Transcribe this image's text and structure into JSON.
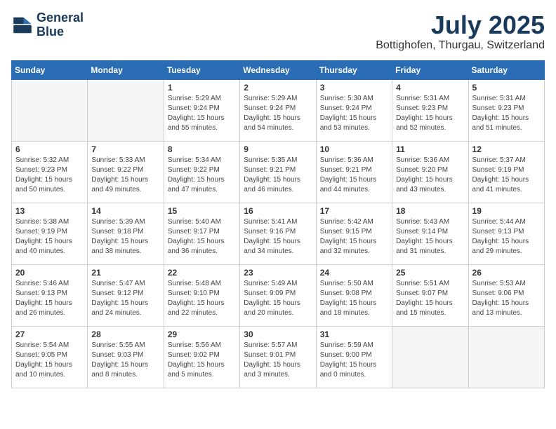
{
  "header": {
    "logo_line1": "General",
    "logo_line2": "Blue",
    "month": "July 2025",
    "location": "Bottighofen, Thurgau, Switzerland"
  },
  "weekdays": [
    "Sunday",
    "Monday",
    "Tuesday",
    "Wednesday",
    "Thursday",
    "Friday",
    "Saturday"
  ],
  "weeks": [
    [
      {
        "day": "",
        "info": ""
      },
      {
        "day": "",
        "info": ""
      },
      {
        "day": "1",
        "info": "Sunrise: 5:29 AM\nSunset: 9:24 PM\nDaylight: 15 hours\nand 55 minutes."
      },
      {
        "day": "2",
        "info": "Sunrise: 5:29 AM\nSunset: 9:24 PM\nDaylight: 15 hours\nand 54 minutes."
      },
      {
        "day": "3",
        "info": "Sunrise: 5:30 AM\nSunset: 9:24 PM\nDaylight: 15 hours\nand 53 minutes."
      },
      {
        "day": "4",
        "info": "Sunrise: 5:31 AM\nSunset: 9:23 PM\nDaylight: 15 hours\nand 52 minutes."
      },
      {
        "day": "5",
        "info": "Sunrise: 5:31 AM\nSunset: 9:23 PM\nDaylight: 15 hours\nand 51 minutes."
      }
    ],
    [
      {
        "day": "6",
        "info": "Sunrise: 5:32 AM\nSunset: 9:23 PM\nDaylight: 15 hours\nand 50 minutes."
      },
      {
        "day": "7",
        "info": "Sunrise: 5:33 AM\nSunset: 9:22 PM\nDaylight: 15 hours\nand 49 minutes."
      },
      {
        "day": "8",
        "info": "Sunrise: 5:34 AM\nSunset: 9:22 PM\nDaylight: 15 hours\nand 47 minutes."
      },
      {
        "day": "9",
        "info": "Sunrise: 5:35 AM\nSunset: 9:21 PM\nDaylight: 15 hours\nand 46 minutes."
      },
      {
        "day": "10",
        "info": "Sunrise: 5:36 AM\nSunset: 9:21 PM\nDaylight: 15 hours\nand 44 minutes."
      },
      {
        "day": "11",
        "info": "Sunrise: 5:36 AM\nSunset: 9:20 PM\nDaylight: 15 hours\nand 43 minutes."
      },
      {
        "day": "12",
        "info": "Sunrise: 5:37 AM\nSunset: 9:19 PM\nDaylight: 15 hours\nand 41 minutes."
      }
    ],
    [
      {
        "day": "13",
        "info": "Sunrise: 5:38 AM\nSunset: 9:19 PM\nDaylight: 15 hours\nand 40 minutes."
      },
      {
        "day": "14",
        "info": "Sunrise: 5:39 AM\nSunset: 9:18 PM\nDaylight: 15 hours\nand 38 minutes."
      },
      {
        "day": "15",
        "info": "Sunrise: 5:40 AM\nSunset: 9:17 PM\nDaylight: 15 hours\nand 36 minutes."
      },
      {
        "day": "16",
        "info": "Sunrise: 5:41 AM\nSunset: 9:16 PM\nDaylight: 15 hours\nand 34 minutes."
      },
      {
        "day": "17",
        "info": "Sunrise: 5:42 AM\nSunset: 9:15 PM\nDaylight: 15 hours\nand 32 minutes."
      },
      {
        "day": "18",
        "info": "Sunrise: 5:43 AM\nSunset: 9:14 PM\nDaylight: 15 hours\nand 31 minutes."
      },
      {
        "day": "19",
        "info": "Sunrise: 5:44 AM\nSunset: 9:13 PM\nDaylight: 15 hours\nand 29 minutes."
      }
    ],
    [
      {
        "day": "20",
        "info": "Sunrise: 5:46 AM\nSunset: 9:13 PM\nDaylight: 15 hours\nand 26 minutes."
      },
      {
        "day": "21",
        "info": "Sunrise: 5:47 AM\nSunset: 9:12 PM\nDaylight: 15 hours\nand 24 minutes."
      },
      {
        "day": "22",
        "info": "Sunrise: 5:48 AM\nSunset: 9:10 PM\nDaylight: 15 hours\nand 22 minutes."
      },
      {
        "day": "23",
        "info": "Sunrise: 5:49 AM\nSunset: 9:09 PM\nDaylight: 15 hours\nand 20 minutes."
      },
      {
        "day": "24",
        "info": "Sunrise: 5:50 AM\nSunset: 9:08 PM\nDaylight: 15 hours\nand 18 minutes."
      },
      {
        "day": "25",
        "info": "Sunrise: 5:51 AM\nSunset: 9:07 PM\nDaylight: 15 hours\nand 15 minutes."
      },
      {
        "day": "26",
        "info": "Sunrise: 5:53 AM\nSunset: 9:06 PM\nDaylight: 15 hours\nand 13 minutes."
      }
    ],
    [
      {
        "day": "27",
        "info": "Sunrise: 5:54 AM\nSunset: 9:05 PM\nDaylight: 15 hours\nand 10 minutes."
      },
      {
        "day": "28",
        "info": "Sunrise: 5:55 AM\nSunset: 9:03 PM\nDaylight: 15 hours\nand 8 minutes."
      },
      {
        "day": "29",
        "info": "Sunrise: 5:56 AM\nSunset: 9:02 PM\nDaylight: 15 hours\nand 5 minutes."
      },
      {
        "day": "30",
        "info": "Sunrise: 5:57 AM\nSunset: 9:01 PM\nDaylight: 15 hours\nand 3 minutes."
      },
      {
        "day": "31",
        "info": "Sunrise: 5:59 AM\nSunset: 9:00 PM\nDaylight: 15 hours\nand 0 minutes."
      },
      {
        "day": "",
        "info": ""
      },
      {
        "day": "",
        "info": ""
      }
    ]
  ]
}
